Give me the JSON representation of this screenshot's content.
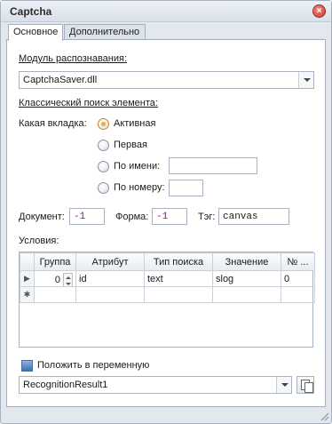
{
  "window": {
    "title": "Captcha",
    "close_icon": "close-icon"
  },
  "tabs": [
    {
      "label": "Основное",
      "active": true
    },
    {
      "label": "Дополнительно",
      "active": false
    }
  ],
  "recognition": {
    "module_label": "Модуль распознавания:",
    "module_value": "CaptchaSaver.dll"
  },
  "search": {
    "section_label": "Классический поиск элемента:",
    "tab_label": "Какая вкладка:",
    "options": [
      {
        "label": "Активная",
        "checked": true
      },
      {
        "label": "Первая",
        "checked": false
      },
      {
        "label": "По имени:",
        "checked": false
      },
      {
        "label": "По номеру:",
        "checked": false
      }
    ],
    "name_value": "",
    "number_value": ""
  },
  "fields": {
    "document_label": "Документ:",
    "document_value": "-1",
    "form_label": "Форма:",
    "form_value": "-1",
    "tag_label": "Тэг:",
    "tag_value": "canvas"
  },
  "conditions": {
    "label": "Условия:",
    "columns": [
      "Группа",
      "Атрибут",
      "Тип поиска",
      "Значение",
      "№ ..."
    ],
    "rows": [
      {
        "group": "0",
        "attribute": "id",
        "search_type": "text",
        "value": "slog",
        "number": "0"
      }
    ]
  },
  "output": {
    "checkbox_label": "Положить в переменную",
    "checked": true,
    "variable_value": "RecognitionResult1"
  }
}
